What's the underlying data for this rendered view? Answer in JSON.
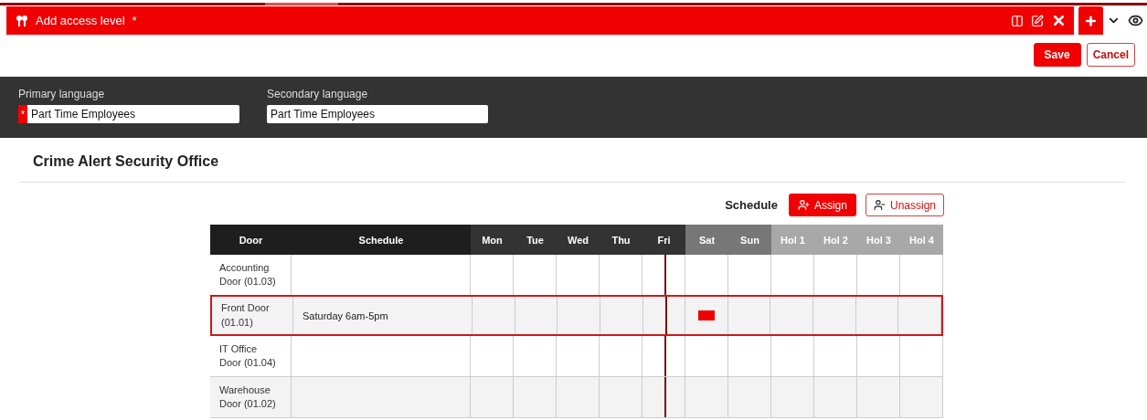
{
  "header": {
    "title": "Add access level",
    "modified_mark": "*"
  },
  "actions": {
    "save": "Save",
    "cancel": "Cancel"
  },
  "languages": [
    {
      "label": "Primary language",
      "value": "Part Time Employees",
      "required": true
    },
    {
      "label": "Secondary language",
      "value": "Part Time Employees",
      "required": false
    }
  ],
  "section_title": "Crime Alert Security Office",
  "schedule_toolbar": {
    "label": "Schedule",
    "assign": "Assign",
    "unassign": "Unassign"
  },
  "table": {
    "columns": [
      {
        "label": "Door",
        "kind": "fixed"
      },
      {
        "label": "Schedule",
        "kind": "fixed"
      },
      {
        "label": "Mon",
        "kind": "weekday"
      },
      {
        "label": "Tue",
        "kind": "weekday"
      },
      {
        "label": "Wed",
        "kind": "weekday"
      },
      {
        "label": "Thu",
        "kind": "weekday"
      },
      {
        "label": "Fri",
        "kind": "weekday"
      },
      {
        "label": "Sat",
        "kind": "weekend"
      },
      {
        "label": "Sun",
        "kind": "weekend"
      },
      {
        "label": "Hol 1",
        "kind": "holiday"
      },
      {
        "label": "Hol 2",
        "kind": "holiday"
      },
      {
        "label": "Hol 3",
        "kind": "holiday"
      },
      {
        "label": "Hol 4",
        "kind": "holiday"
      }
    ],
    "rows": [
      {
        "door": "Accounting Door (01.03)",
        "schedule": "",
        "selected": false,
        "cells": [
          {
            "filled": false
          },
          {
            "filled": false
          },
          {
            "filled": false
          },
          {
            "filled": false
          },
          {
            "filled": false
          },
          {
            "filled": false
          },
          {
            "filled": false
          },
          {
            "filled": false
          },
          {
            "filled": false
          },
          {
            "filled": false
          },
          {
            "filled": false
          }
        ]
      },
      {
        "door": "Front Door (01.01)",
        "schedule": "Saturday 6am-5pm",
        "selected": true,
        "cells": [
          {
            "filled": false
          },
          {
            "filled": false
          },
          {
            "filled": false
          },
          {
            "filled": false
          },
          {
            "filled": false
          },
          {
            "filled": true
          },
          {
            "filled": false
          },
          {
            "filled": false
          },
          {
            "filled": false
          },
          {
            "filled": false
          },
          {
            "filled": false
          }
        ]
      },
      {
        "door": "IT Office Door (01.04)",
        "schedule": "",
        "selected": false,
        "cells": [
          {
            "filled": false
          },
          {
            "filled": false
          },
          {
            "filled": false
          },
          {
            "filled": false
          },
          {
            "filled": false
          },
          {
            "filled": false
          },
          {
            "filled": false
          },
          {
            "filled": false
          },
          {
            "filled": false
          },
          {
            "filled": false
          },
          {
            "filled": false
          }
        ]
      },
      {
        "door": "Warehouse Door (01.02)",
        "schedule": "",
        "selected": false,
        "cells": [
          {
            "filled": false
          },
          {
            "filled": false
          },
          {
            "filled": false
          },
          {
            "filled": false
          },
          {
            "filled": false
          },
          {
            "filled": false
          },
          {
            "filled": false
          },
          {
            "filled": false
          },
          {
            "filled": false
          },
          {
            "filled": false
          },
          {
            "filled": false
          }
        ]
      }
    ]
  }
}
